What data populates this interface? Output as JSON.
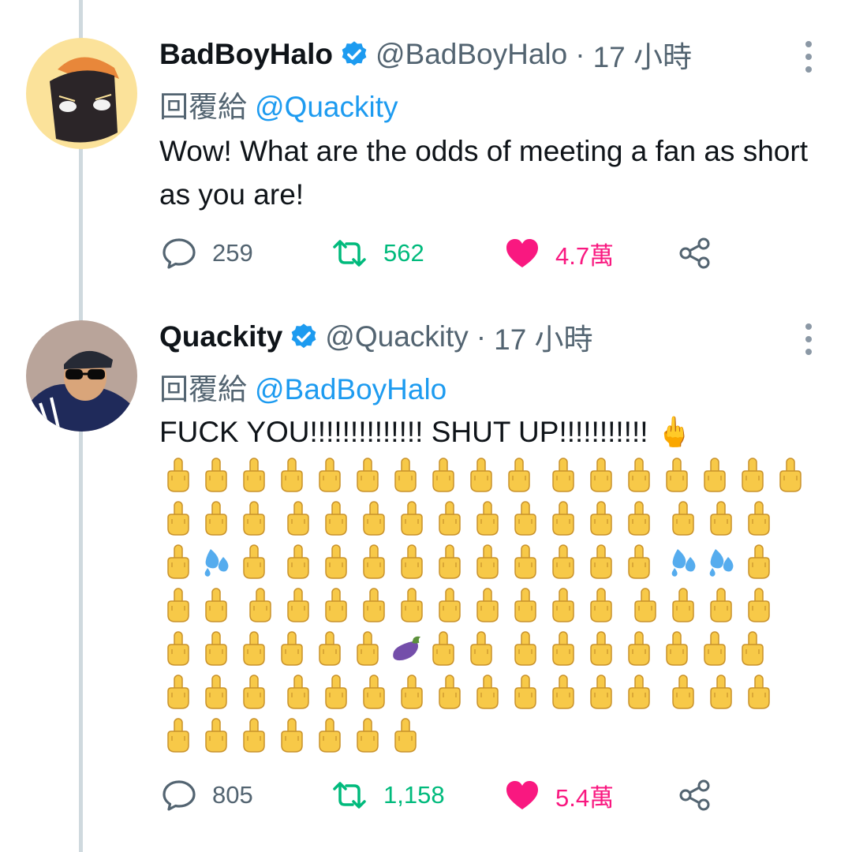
{
  "colors": {
    "accent_blue": "#1d9bf0",
    "retweet_green": "#00ba7c",
    "like_pink": "#f91880",
    "secondary_text": "#536471",
    "thread_line": "#cfd9de"
  },
  "tweets": [
    {
      "display_name": "BadBoyHalo",
      "handle": "@BadBoyHalo",
      "separator": "·",
      "time": "17 小時",
      "verified_icon": "verified-badge-icon",
      "reply_prefix": "回覆給",
      "reply_mention": "@Quackity",
      "text": "Wow! What are the odds of meeting a fan as short as you are!",
      "replies": "259",
      "retweets": "562",
      "likes": "4.7萬",
      "liked": true
    },
    {
      "display_name": "Quackity",
      "handle": "@Quackity",
      "separator": "·",
      "time": "17 小時",
      "verified_icon": "verified-badge-icon",
      "reply_prefix": "回覆給",
      "reply_mention": "@BadBoyHalo",
      "text": "FUCK YOU!!!!!!!!!!!!!! SHUT UP!!!!!!!!!!! 🖕",
      "emoji_rows": [
        [
          "F",
          "F",
          "F",
          "F",
          "F",
          "F",
          "F",
          "F",
          "F",
          "F",
          "_",
          "F",
          "F",
          "F",
          "F",
          "F",
          "F",
          "F"
        ],
        [
          "F",
          "F",
          "F",
          "_",
          "F",
          "F",
          "F",
          "F",
          "F",
          "F",
          "F",
          "F",
          "F",
          "F",
          "_",
          "F",
          "F",
          "F"
        ],
        [
          "F",
          "S",
          "F",
          "_",
          "F",
          "F",
          "F",
          "F",
          "F",
          "F",
          "F",
          "F",
          "F",
          "F",
          "_",
          "S",
          "S",
          "F"
        ],
        [
          "F",
          "F",
          "_",
          "F",
          "F",
          "F",
          "F",
          "F",
          "F",
          "F",
          "F",
          "F",
          "F",
          "_",
          "F",
          "F",
          "F",
          "F"
        ],
        [
          "F",
          "F",
          "F",
          "F",
          "F",
          "F",
          "E",
          "F",
          "F",
          "_",
          "F",
          "F",
          "F",
          "F",
          "F",
          "F",
          "F"
        ],
        [
          "F",
          "F",
          "F",
          "_",
          "F",
          "F",
          "F",
          "F",
          "F",
          "F",
          "F",
          "F",
          "F",
          "F",
          "_",
          "F",
          "F",
          "F"
        ],
        [
          "F",
          "F",
          "F",
          "F",
          "F",
          "F",
          "F"
        ]
      ],
      "emoji_legend": {
        "F": "middle-finger",
        "S": "sweat-droplets",
        "E": "eggplant"
      },
      "replies": "805",
      "retweets": "1,158",
      "likes": "5.4萬",
      "liked": true
    }
  ]
}
